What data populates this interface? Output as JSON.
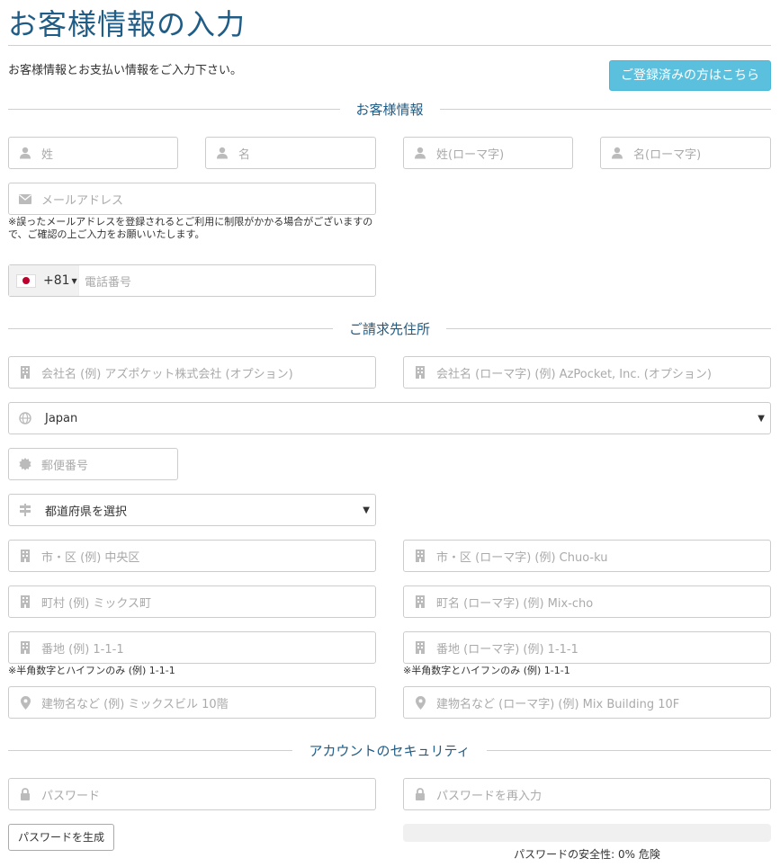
{
  "page": {
    "title": "お客様情報の入力",
    "intro": "お客様情報とお支払い情報をご入力下さい。",
    "login_button": "ご登録済みの方はこちら"
  },
  "sections": {
    "customer": "お客様情報",
    "billing": "ご請求先住所",
    "security": "アカウントのセキュリティ"
  },
  "customer": {
    "last_name_placeholder": "姓",
    "first_name_placeholder": "名",
    "last_name_roman_placeholder": "姓(ローマ字)",
    "first_name_roman_placeholder": "名(ローマ字)",
    "email_placeholder": "メールアドレス",
    "email_note": "※誤ったメールアドレスを登録されるとご利用に制限がかかる場合がございますので、ご確認の上ご入力をお願いいたします。",
    "phone_dial_code": "+81",
    "phone_placeholder": "電話番号"
  },
  "billing": {
    "company_placeholder": "会社名 (例) アズポケット株式会社 (オプション)",
    "company_roman_placeholder": "会社名 (ローマ字) (例) AzPocket, Inc. (オプション)",
    "country_value": "Japan",
    "postal_placeholder": "郵便番号",
    "prefecture_value": "都道府県を選択",
    "city_placeholder": "市・区 (例) 中央区",
    "city_roman_placeholder": "市・区 (ローマ字) (例) Chuo-ku",
    "town_placeholder": "町村 (例) ミックス町",
    "town_roman_placeholder": "町名 (ローマ字) (例) Mix-cho",
    "block_placeholder": "番地 (例) 1-1-1",
    "block_roman_placeholder": "番地 (ローマ字) (例) 1-1-1",
    "block_note": "※半角数字とハイフンのみ (例) 1-1-1",
    "block_roman_note": "※半角数字とハイフンのみ (例) 1-1-1",
    "building_placeholder": "建物名など (例) ミックスビル 10階",
    "building_roman_placeholder": "建物名など (ローマ字) (例) Mix Building 10F"
  },
  "security": {
    "password_placeholder": "パスワード",
    "password_confirm_placeholder": "パスワードを再入力",
    "generate_button": "パスワードを生成",
    "strength_text": "パスワードの安全性: 0% 危険",
    "strength_percent": 0
  },
  "colors": {
    "title": "#1f5c86",
    "login_button": "#5bc0de",
    "border": "#cccccc"
  }
}
